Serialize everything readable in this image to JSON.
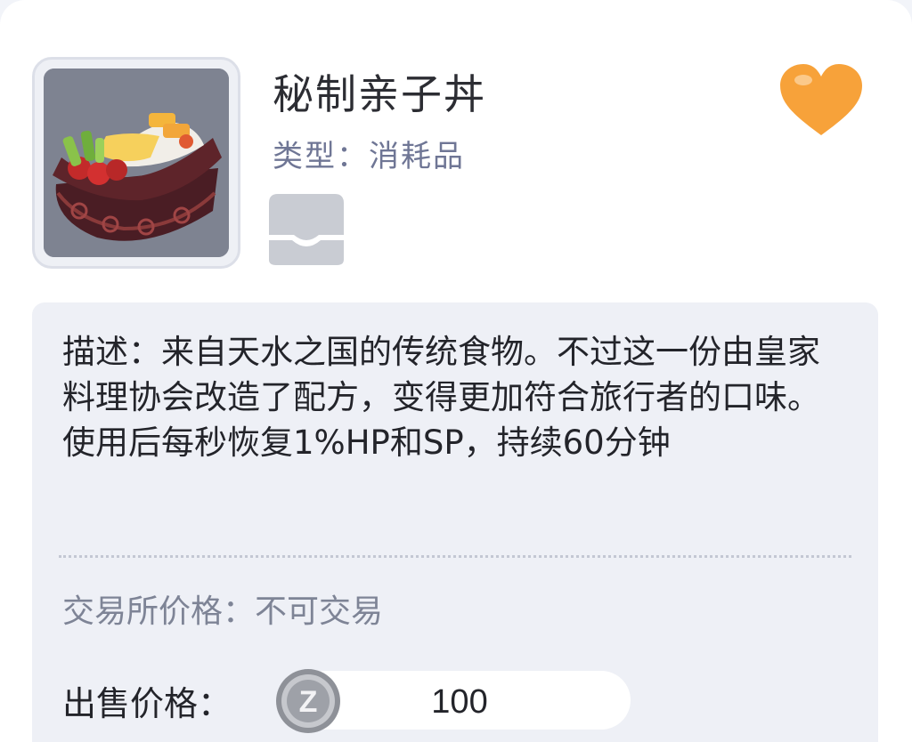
{
  "item": {
    "name": "秘制亲子丼",
    "type_line": "类型：消耗品",
    "thumbnail_icon": "bento-box-icon",
    "favorite_icon": "heart-icon",
    "favorite_color": "#f7a23a",
    "storage_icon": "inbox-tray-icon"
  },
  "details": {
    "description": "描述：来自天水之国的传统食物。不过这一份由皇家料理协会改造了配方，变得更加符合旅行者的口味。使用后每秒恢复1%HP和SP，持续60分钟",
    "trade_line": "交易所价格：不可交易",
    "sell_label": "出售价格：",
    "sell_price": "100",
    "currency_icon": "zeny-coin-icon"
  },
  "colors": {
    "panel_background": "#eef0f6",
    "type_text": "#6f7695"
  }
}
